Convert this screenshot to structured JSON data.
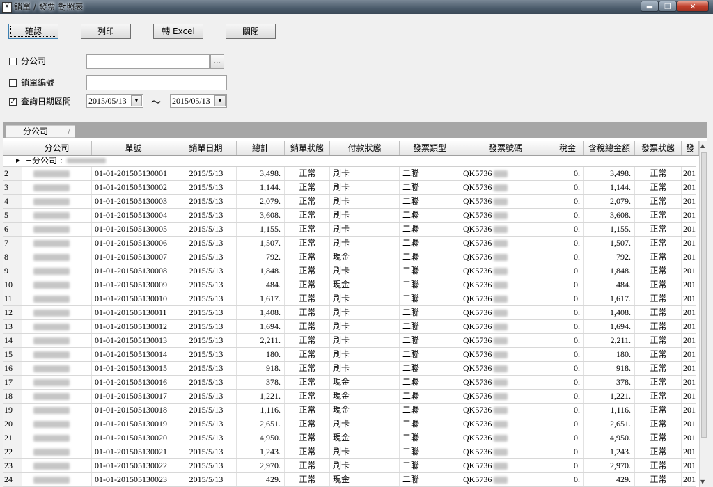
{
  "window": {
    "title": "銷單 / 發票 對照表",
    "icon": "app-icon",
    "buttons": {
      "minimize": "▬",
      "maximize": "❐",
      "close": "✕"
    }
  },
  "toolbar": {
    "confirm": "確認",
    "print": "列印",
    "excel": "轉 Excel",
    "close": "關閉"
  },
  "filters": {
    "branch_label": "分公司",
    "branch_value": "",
    "branch_checked": false,
    "browse": "...",
    "order_label": "銷單編號",
    "order_value": "",
    "order_checked": false,
    "date_label": "查詢日期區間",
    "date_checked": true,
    "date_from": "2015/05/13",
    "date_to": "2015/05/13",
    "date_sep": "～"
  },
  "grid": {
    "group_chip": "分公司",
    "group_row_label": "分公司 :",
    "columns": [
      "分公司",
      "單號",
      "銷單日期",
      "總計",
      "銷單狀態",
      "付款狀態",
      "發票類型",
      "發票號碼",
      "稅金",
      "含稅總金額",
      "發票狀態",
      "發"
    ],
    "rows": [
      {
        "n": "2",
        "order": "01-01-201505130001",
        "date": "2015/5/13",
        "total": "3,498.",
        "status": "正常",
        "pay": "刷卡",
        "inv_type": "二聯",
        "inv_no": "QK5736",
        "tax": "0.",
        "gross": "3,498.",
        "inv_status": "正常",
        "extra": "201"
      },
      {
        "n": "3",
        "order": "01-01-201505130002",
        "date": "2015/5/13",
        "total": "1,144.",
        "status": "正常",
        "pay": "刷卡",
        "inv_type": "二聯",
        "inv_no": "QK5736",
        "tax": "0.",
        "gross": "1,144.",
        "inv_status": "正常",
        "extra": "201"
      },
      {
        "n": "4",
        "order": "01-01-201505130003",
        "date": "2015/5/13",
        "total": "2,079.",
        "status": "正常",
        "pay": "刷卡",
        "inv_type": "二聯",
        "inv_no": "QK5736",
        "tax": "0.",
        "gross": "2,079.",
        "inv_status": "正常",
        "extra": "201"
      },
      {
        "n": "5",
        "order": "01-01-201505130004",
        "date": "2015/5/13",
        "total": "3,608.",
        "status": "正常",
        "pay": "刷卡",
        "inv_type": "二聯",
        "inv_no": "QK5736",
        "tax": "0.",
        "gross": "3,608.",
        "inv_status": "正常",
        "extra": "201"
      },
      {
        "n": "6",
        "order": "01-01-201505130005",
        "date": "2015/5/13",
        "total": "1,155.",
        "status": "正常",
        "pay": "刷卡",
        "inv_type": "二聯",
        "inv_no": "QK5736",
        "tax": "0.",
        "gross": "1,155.",
        "inv_status": "正常",
        "extra": "201"
      },
      {
        "n": "7",
        "order": "01-01-201505130006",
        "date": "2015/5/13",
        "total": "1,507.",
        "status": "正常",
        "pay": "刷卡",
        "inv_type": "二聯",
        "inv_no": "QK5736",
        "tax": "0.",
        "gross": "1,507.",
        "inv_status": "正常",
        "extra": "201"
      },
      {
        "n": "8",
        "order": "01-01-201505130007",
        "date": "2015/5/13",
        "total": "792.",
        "status": "正常",
        "pay": "現金",
        "inv_type": "二聯",
        "inv_no": "QK5736",
        "tax": "0.",
        "gross": "792.",
        "inv_status": "正常",
        "extra": "201"
      },
      {
        "n": "9",
        "order": "01-01-201505130008",
        "date": "2015/5/13",
        "total": "1,848.",
        "status": "正常",
        "pay": "刷卡",
        "inv_type": "二聯",
        "inv_no": "QK5736",
        "tax": "0.",
        "gross": "1,848.",
        "inv_status": "正常",
        "extra": "201"
      },
      {
        "n": "10",
        "order": "01-01-201505130009",
        "date": "2015/5/13",
        "total": "484.",
        "status": "正常",
        "pay": "現金",
        "inv_type": "二聯",
        "inv_no": "QK5736",
        "tax": "0.",
        "gross": "484.",
        "inv_status": "正常",
        "extra": "201"
      },
      {
        "n": "11",
        "order": "01-01-201505130010",
        "date": "2015/5/13",
        "total": "1,617.",
        "status": "正常",
        "pay": "刷卡",
        "inv_type": "二聯",
        "inv_no": "QK5736",
        "tax": "0.",
        "gross": "1,617.",
        "inv_status": "正常",
        "extra": "201"
      },
      {
        "n": "12",
        "order": "01-01-201505130011",
        "date": "2015/5/13",
        "total": "1,408.",
        "status": "正常",
        "pay": "刷卡",
        "inv_type": "二聯",
        "inv_no": "QK5736",
        "tax": "0.",
        "gross": "1,408.",
        "inv_status": "正常",
        "extra": "201"
      },
      {
        "n": "13",
        "order": "01-01-201505130012",
        "date": "2015/5/13",
        "total": "1,694.",
        "status": "正常",
        "pay": "刷卡",
        "inv_type": "二聯",
        "inv_no": "QK5736",
        "tax": "0.",
        "gross": "1,694.",
        "inv_status": "正常",
        "extra": "201"
      },
      {
        "n": "14",
        "order": "01-01-201505130013",
        "date": "2015/5/13",
        "total": "2,211.",
        "status": "正常",
        "pay": "刷卡",
        "inv_type": "二聯",
        "inv_no": "QK5736",
        "tax": "0.",
        "gross": "2,211.",
        "inv_status": "正常",
        "extra": "201"
      },
      {
        "n": "15",
        "order": "01-01-201505130014",
        "date": "2015/5/13",
        "total": "180.",
        "status": "正常",
        "pay": "刷卡",
        "inv_type": "二聯",
        "inv_no": "QK5736",
        "tax": "0.",
        "gross": "180.",
        "inv_status": "正常",
        "extra": "201"
      },
      {
        "n": "16",
        "order": "01-01-201505130015",
        "date": "2015/5/13",
        "total": "918.",
        "status": "正常",
        "pay": "刷卡",
        "inv_type": "二聯",
        "inv_no": "QK5736",
        "tax": "0.",
        "gross": "918.",
        "inv_status": "正常",
        "extra": "201"
      },
      {
        "n": "17",
        "order": "01-01-201505130016",
        "date": "2015/5/13",
        "total": "378.",
        "status": "正常",
        "pay": "現金",
        "inv_type": "二聯",
        "inv_no": "QK5736",
        "tax": "0.",
        "gross": "378.",
        "inv_status": "正常",
        "extra": "201"
      },
      {
        "n": "18",
        "order": "01-01-201505130017",
        "date": "2015/5/13",
        "total": "1,221.",
        "status": "正常",
        "pay": "現金",
        "inv_type": "二聯",
        "inv_no": "QK5736",
        "tax": "0.",
        "gross": "1,221.",
        "inv_status": "正常",
        "extra": "201"
      },
      {
        "n": "19",
        "order": "01-01-201505130018",
        "date": "2015/5/13",
        "total": "1,116.",
        "status": "正常",
        "pay": "現金",
        "inv_type": "二聯",
        "inv_no": "QK5736",
        "tax": "0.",
        "gross": "1,116.",
        "inv_status": "正常",
        "extra": "201"
      },
      {
        "n": "20",
        "order": "01-01-201505130019",
        "date": "2015/5/13",
        "total": "2,651.",
        "status": "正常",
        "pay": "刷卡",
        "inv_type": "二聯",
        "inv_no": "QK5736",
        "tax": "0.",
        "gross": "2,651.",
        "inv_status": "正常",
        "extra": "201"
      },
      {
        "n": "21",
        "order": "01-01-201505130020",
        "date": "2015/5/13",
        "total": "4,950.",
        "status": "正常",
        "pay": "現金",
        "inv_type": "二聯",
        "inv_no": "QK5736",
        "tax": "0.",
        "gross": "4,950.",
        "inv_status": "正常",
        "extra": "201"
      },
      {
        "n": "22",
        "order": "01-01-201505130021",
        "date": "2015/5/13",
        "total": "1,243.",
        "status": "正常",
        "pay": "刷卡",
        "inv_type": "二聯",
        "inv_no": "QK5736",
        "tax": "0.",
        "gross": "1,243.",
        "inv_status": "正常",
        "extra": "201"
      },
      {
        "n": "23",
        "order": "01-01-201505130022",
        "date": "2015/5/13",
        "total": "2,970.",
        "status": "正常",
        "pay": "刷卡",
        "inv_type": "二聯",
        "inv_no": "QK5736",
        "tax": "0.",
        "gross": "2,970.",
        "inv_status": "正常",
        "extra": "201"
      },
      {
        "n": "24",
        "order": "01-01-201505130023",
        "date": "2015/5/13",
        "total": "429.",
        "status": "正常",
        "pay": "現金",
        "inv_type": "二聯",
        "inv_no": "QK5736",
        "tax": "0.",
        "gross": "429.",
        "inv_status": "正常",
        "extra": "201"
      }
    ]
  }
}
